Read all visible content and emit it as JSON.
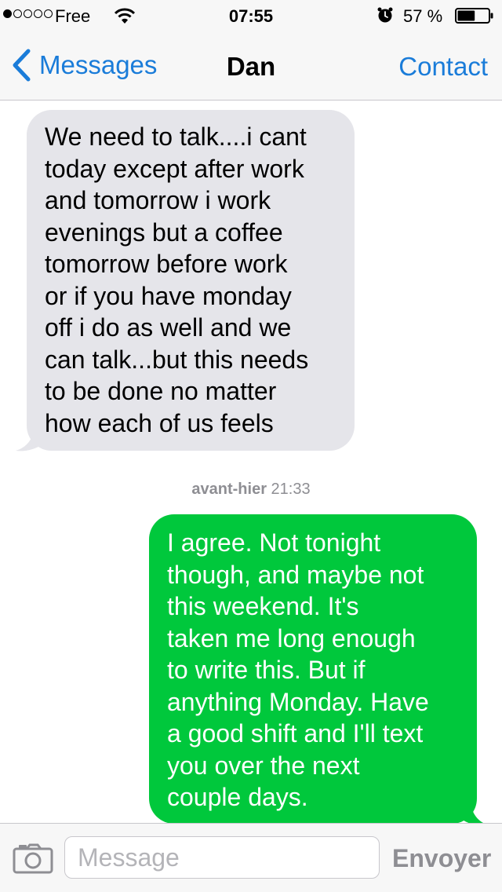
{
  "status_bar": {
    "signal_filled": 1,
    "signal_total": 5,
    "carrier": "Free",
    "time": "07:55",
    "battery_percent": "57 %",
    "battery_level": 0.57
  },
  "nav": {
    "back_label": "Messages",
    "title": "Dan",
    "contact_label": "Contact"
  },
  "messages": [
    {
      "direction": "incoming",
      "lines": [
        "We need to talk....i cant",
        "today except after work",
        "and tomorrow i work",
        "evenings but a coffee",
        "tomorrow before work",
        "or if you have monday",
        "off i do as well and we",
        "can talk...but this needs",
        "to be done no matter",
        "how each of us feels"
      ]
    },
    {
      "direction": "outgoing",
      "timestamp_day": "avant-hier",
      "timestamp_time": "21:33",
      "lines": [
        "I agree.  Not tonight",
        "though, and maybe not",
        "this weekend.  It's",
        "taken me long enough",
        "to write this.  But if",
        "anything Monday.  Have",
        "a good shift and I'll text",
        "you over the next",
        "couple days."
      ]
    }
  ],
  "input_bar": {
    "placeholder": "Message",
    "value": "",
    "send_label": "Envoyer"
  },
  "colors": {
    "accent": "#1a7cd9",
    "incoming_bubble": "#e5e5ea",
    "outgoing_bubble": "#00c83c"
  },
  "icons": {
    "back": "chevron-left-icon",
    "wifi": "wifi-icon",
    "alarm": "alarm-icon",
    "battery": "battery-icon",
    "camera": "camera-icon"
  }
}
